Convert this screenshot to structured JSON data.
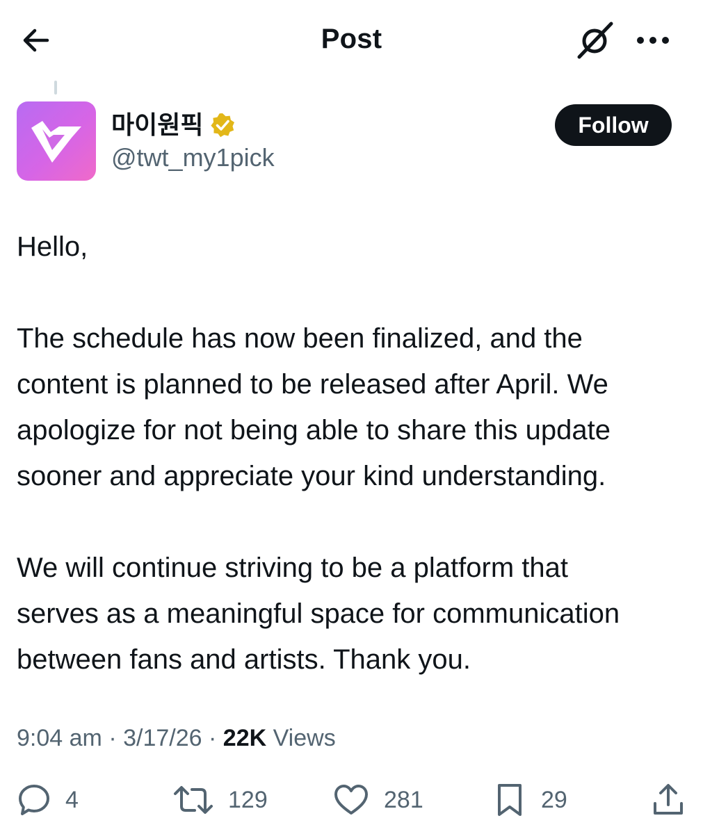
{
  "header": {
    "title": "Post",
    "back_icon": "arrow-left-icon",
    "grok_icon": "grok-icon",
    "more_icon": "more-horizontal-icon"
  },
  "author": {
    "display_name": "마이원픽",
    "handle": "@twt_my1pick",
    "verified_badge": "verified-badge-icon",
    "verified_color": "#e2b719",
    "avatar_colors": [
      "#b86bf2",
      "#f06ac9"
    ]
  },
  "follow_button": {
    "label": "Follow"
  },
  "post": {
    "paragraphs": [
      {
        "lines": [
          "Hello,"
        ]
      },
      {
        "lines": [
          "The schedule has now been finalized, and the",
          "content is planned to be released after April. We",
          "apologize for not being able to share this update",
          "sooner and appreciate your kind understanding."
        ]
      },
      {
        "lines": [
          "We will continue striving to be a platform that",
          "serves as a meaningful space for communication",
          "between fans and artists. Thank you."
        ]
      }
    ]
  },
  "meta": {
    "time": "9:04 am",
    "separator": "·",
    "date": "3/17/26",
    "views_count": "22K",
    "views_label": "Views"
  },
  "actions": {
    "replies": "4",
    "reposts": "129",
    "likes": "281",
    "bookmarks": "29"
  },
  "colors": {
    "text": "#0f1419",
    "secondary": "#536471"
  }
}
